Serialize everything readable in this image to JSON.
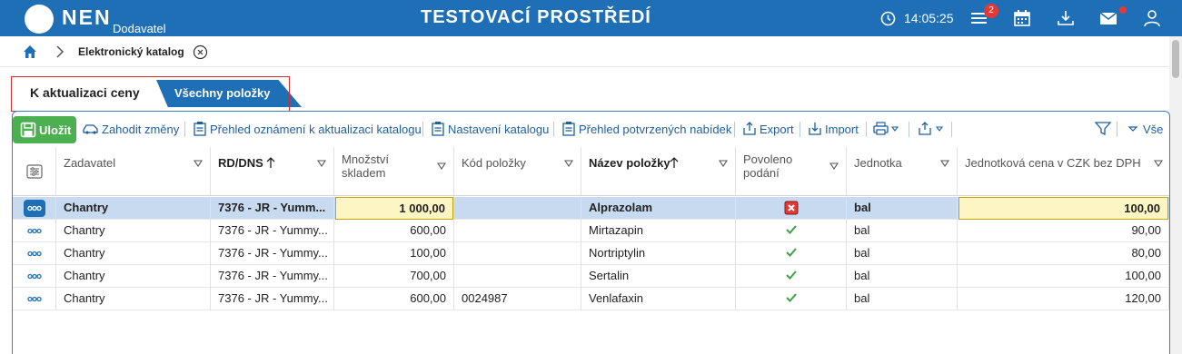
{
  "topbar": {
    "brand": "NEN",
    "brand_sub": "Dodavatel",
    "env_title": "TESTOVACÍ PROSTŘEDÍ",
    "time": "14:05:25",
    "notif_count": "2",
    "accent": "#1f6fb6",
    "icons": [
      "clock-icon",
      "menu-icon",
      "calendar-icon",
      "download-icon",
      "mail-icon",
      "user-icon"
    ]
  },
  "breadcrumb": {
    "label": "Elektronický katalog"
  },
  "tabs": [
    {
      "label": "K aktualizaci ceny",
      "active": true
    },
    {
      "label": "Všechny položky",
      "active": false
    }
  ],
  "toolbar": {
    "save": "Uložit",
    "discard": "Zahodit změny",
    "overview_notices": "Přehled oznámení k aktualizaci katalogu",
    "catalog_settings": "Nastavení katalogu",
    "confirmed_offers": "Přehled potvrzených nabídek",
    "export": "Export",
    "import": "Import",
    "all": "Vše"
  },
  "columns": {
    "zadavatel": "Zadavatel",
    "rddns": "RD/DNS",
    "mnozstvi_1": "Množství",
    "mnozstvi_2": "skladem",
    "kod": "Kód položky",
    "nazev": "Název položky",
    "povoleno_1": "Povoleno",
    "povoleno_2": "podání",
    "jednotka": "Jednotka",
    "cena": "Jednotková cena v CZK bez DPH"
  },
  "rows": [
    {
      "zadavatel": "Chantry",
      "rddns": "7376 - JR - Yumm...",
      "mnozstvi": "1 000,00",
      "kod": "",
      "nazev": "Alprazolam",
      "povoleno": false,
      "jednotka": "bal",
      "cena": "100,00"
    },
    {
      "zadavatel": "Chantry",
      "rddns": "7376 - JR - Yummy...",
      "mnozstvi": "600,00",
      "kod": "",
      "nazev": "Mirtazapin",
      "povoleno": true,
      "jednotka": "bal",
      "cena": "90,00"
    },
    {
      "zadavatel": "Chantry",
      "rddns": "7376 - JR - Yummy...",
      "mnozstvi": "100,00",
      "kod": "",
      "nazev": "Nortriptylin",
      "povoleno": true,
      "jednotka": "bal",
      "cena": "80,00"
    },
    {
      "zadavatel": "Chantry",
      "rddns": "7376 - JR - Yummy...",
      "mnozstvi": "700,00",
      "kod": "",
      "nazev": "Sertalin",
      "povoleno": true,
      "jednotka": "bal",
      "cena": "100,00"
    },
    {
      "zadavatel": "Chantry",
      "rddns": "7376 - JR - Yummy...",
      "mnozstvi": "600,00",
      "kod": "0024987",
      "nazev": "Venlafaxin",
      "povoleno": true,
      "jednotka": "bal",
      "cena": "120,00"
    }
  ]
}
